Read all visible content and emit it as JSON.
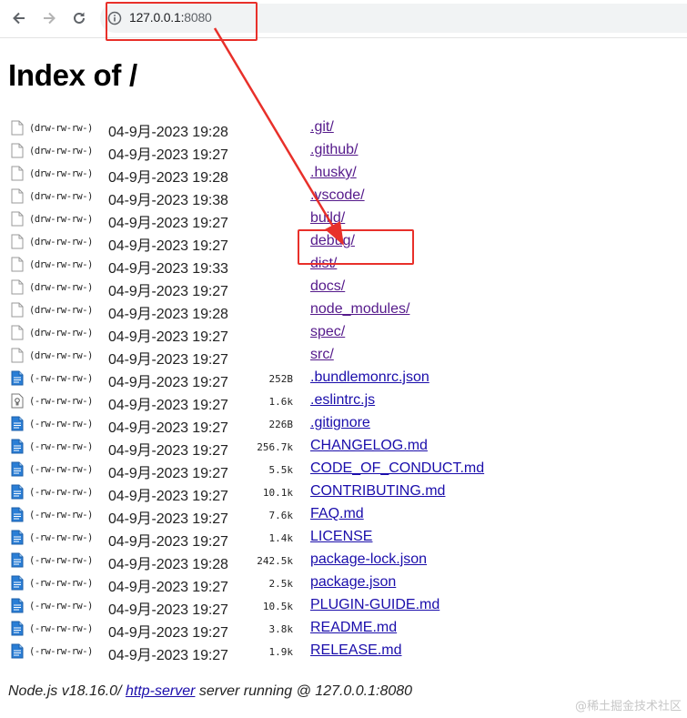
{
  "browser": {
    "back_icon": "arrow-left-icon",
    "forward_icon": "arrow-right-icon",
    "reload_icon": "reload-icon",
    "info_icon": "info-icon",
    "url_host": "127.0.0.1:",
    "url_port": "8080"
  },
  "page": {
    "title": "Index of /"
  },
  "entries": [
    {
      "icon": "folder-icon",
      "perm": "(drw-rw-rw-)",
      "mtime": "04-9月-2023 19:28",
      "size": "",
      "name": ".git/",
      "type": "dir"
    },
    {
      "icon": "folder-icon",
      "perm": "(drw-rw-rw-)",
      "mtime": "04-9月-2023 19:27",
      "size": "",
      "name": ".github/",
      "type": "dir"
    },
    {
      "icon": "folder-icon",
      "perm": "(drw-rw-rw-)",
      "mtime": "04-9月-2023 19:28",
      "size": "",
      "name": ".husky/",
      "type": "dir"
    },
    {
      "icon": "folder-icon",
      "perm": "(drw-rw-rw-)",
      "mtime": "04-9月-2023 19:38",
      "size": "",
      "name": ".vscode/",
      "type": "dir"
    },
    {
      "icon": "folder-icon",
      "perm": "(drw-rw-rw-)",
      "mtime": "04-9月-2023 19:27",
      "size": "",
      "name": "build/",
      "type": "dir"
    },
    {
      "icon": "folder-icon",
      "perm": "(drw-rw-rw-)",
      "mtime": "04-9月-2023 19:27",
      "size": "",
      "name": "debug/",
      "type": "dir"
    },
    {
      "icon": "folder-icon",
      "perm": "(drw-rw-rw-)",
      "mtime": "04-9月-2023 19:33",
      "size": "",
      "name": "dist/",
      "type": "dir"
    },
    {
      "icon": "folder-icon",
      "perm": "(drw-rw-rw-)",
      "mtime": "04-9月-2023 19:27",
      "size": "",
      "name": "docs/",
      "type": "dir"
    },
    {
      "icon": "folder-icon",
      "perm": "(drw-rw-rw-)",
      "mtime": "04-9月-2023 19:28",
      "size": "",
      "name": "node_modules/",
      "type": "dir"
    },
    {
      "icon": "folder-icon",
      "perm": "(drw-rw-rw-)",
      "mtime": "04-9月-2023 19:27",
      "size": "",
      "name": "spec/",
      "type": "dir"
    },
    {
      "icon": "folder-icon",
      "perm": "(drw-rw-rw-)",
      "mtime": "04-9月-2023 19:27",
      "size": "",
      "name": "src/",
      "type": "dir"
    },
    {
      "icon": "document-icon",
      "perm": "(-rw-rw-rw-)",
      "mtime": "04-9月-2023 19:27",
      "size": "252B",
      "name": ".bundlemonrc.json",
      "type": "file"
    },
    {
      "icon": "script-file-icon",
      "perm": "(-rw-rw-rw-)",
      "mtime": "04-9月-2023 19:27",
      "size": "1.6k",
      "name": ".eslintrc.js",
      "type": "file"
    },
    {
      "icon": "document-icon",
      "perm": "(-rw-rw-rw-)",
      "mtime": "04-9月-2023 19:27",
      "size": "226B",
      "name": ".gitignore",
      "type": "file"
    },
    {
      "icon": "document-icon",
      "perm": "(-rw-rw-rw-)",
      "mtime": "04-9月-2023 19:27",
      "size": "256.7k",
      "name": "CHANGELOG.md",
      "type": "file"
    },
    {
      "icon": "document-icon",
      "perm": "(-rw-rw-rw-)",
      "mtime": "04-9月-2023 19:27",
      "size": "5.5k",
      "name": "CODE_OF_CONDUCT.md",
      "type": "file"
    },
    {
      "icon": "document-icon",
      "perm": "(-rw-rw-rw-)",
      "mtime": "04-9月-2023 19:27",
      "size": "10.1k",
      "name": "CONTRIBUTING.md",
      "type": "file"
    },
    {
      "icon": "document-icon",
      "perm": "(-rw-rw-rw-)",
      "mtime": "04-9月-2023 19:27",
      "size": "7.6k",
      "name": "FAQ.md",
      "type": "file"
    },
    {
      "icon": "document-icon",
      "perm": "(-rw-rw-rw-)",
      "mtime": "04-9月-2023 19:27",
      "size": "1.4k",
      "name": "LICENSE",
      "type": "file"
    },
    {
      "icon": "document-icon",
      "perm": "(-rw-rw-rw-)",
      "mtime": "04-9月-2023 19:28",
      "size": "242.5k",
      "name": "package-lock.json",
      "type": "file"
    },
    {
      "icon": "document-icon",
      "perm": "(-rw-rw-rw-)",
      "mtime": "04-9月-2023 19:27",
      "size": "2.5k",
      "name": "package.json",
      "type": "file"
    },
    {
      "icon": "document-icon",
      "perm": "(-rw-rw-rw-)",
      "mtime": "04-9月-2023 19:27",
      "size": "10.5k",
      "name": "PLUGIN-GUIDE.md",
      "type": "file"
    },
    {
      "icon": "document-icon",
      "perm": "(-rw-rw-rw-)",
      "mtime": "04-9月-2023 19:27",
      "size": "3.8k",
      "name": "README.md",
      "type": "file"
    },
    {
      "icon": "document-icon",
      "perm": "(-rw-rw-rw-)",
      "mtime": "04-9月-2023 19:27",
      "size": "1.9k",
      "name": "RELEASE.md",
      "type": "file"
    }
  ],
  "footer": {
    "prefix": "Node.js v18.16.0/ ",
    "link": "http-server",
    "suffix": " server running @ 127.0.0.1:8080"
  },
  "watermark": "@稀土掘金技术社区",
  "colors": {
    "annotation": "#e8302a",
    "link": "#1a0dab",
    "visited": "#551a8b"
  }
}
